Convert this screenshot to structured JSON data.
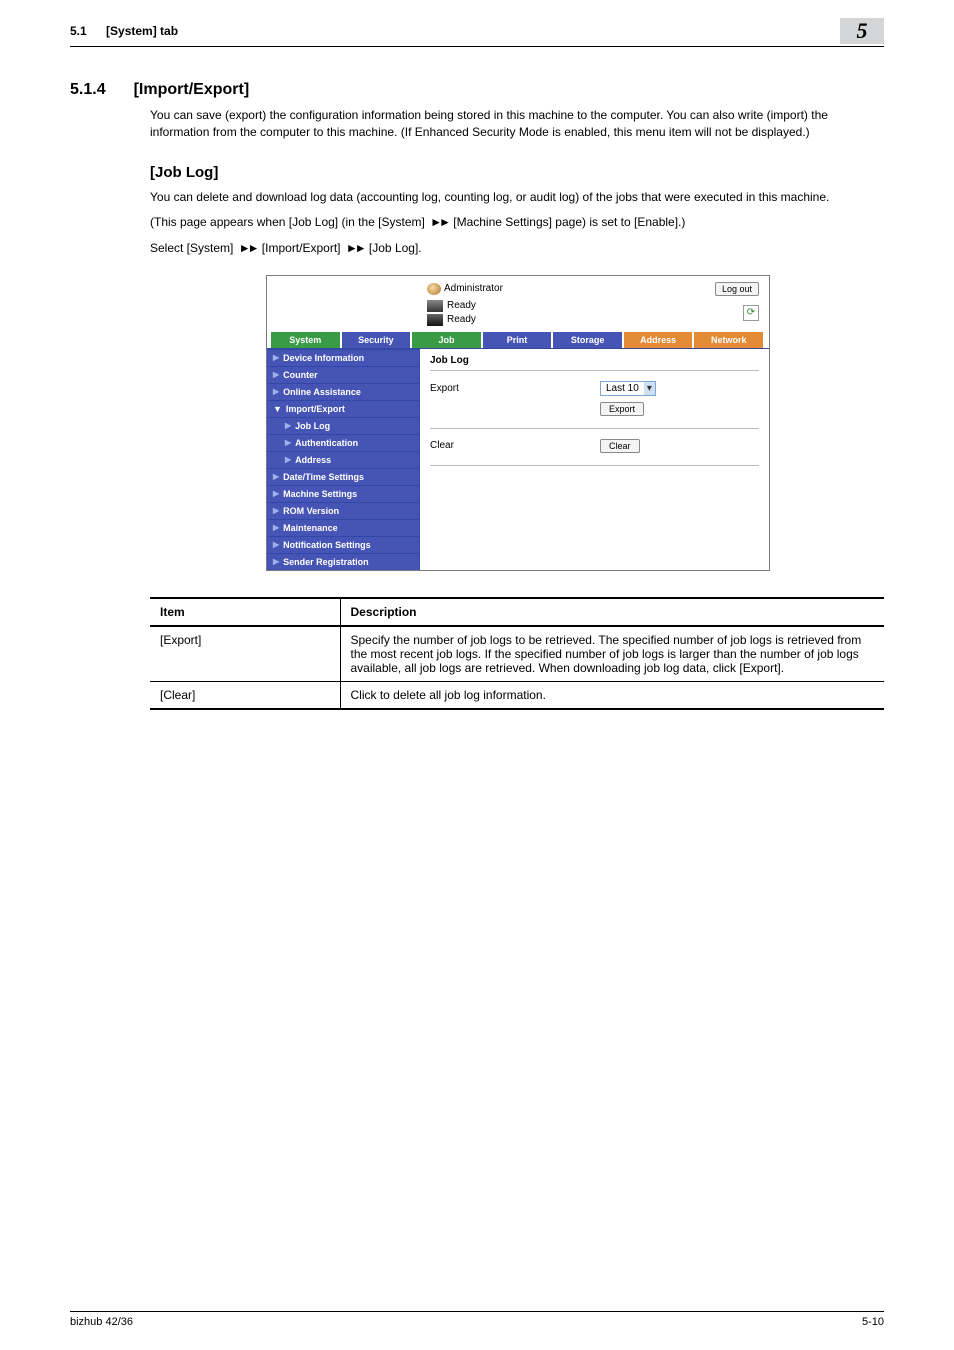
{
  "header": {
    "section_ref": "5.1",
    "section_title": "[System] tab",
    "chapter": "5"
  },
  "section": {
    "number": "5.1.4",
    "title": "[Import/Export]",
    "intro": "You can save (export) the configuration information being stored in this machine to the computer. You can also write (import) the information from the computer to this machine. (If Enhanced Security Mode is enabled, this menu item will not be displayed.)"
  },
  "joblog": {
    "heading": "[Job Log]",
    "p1": "You can delete and download log data (accounting log, counting log, or audit log) of the jobs that were executed in this machine.",
    "p2_pre": "(This page appears when [Job Log] (in the [System] ",
    "p2_mid": " [Machine Settings] page) is set to [Enable].)",
    "p3_a": "Select [System] ",
    "p3_b": " [Import/Export] ",
    "p3_c": " [Job Log]."
  },
  "shot": {
    "user_label": "Administrator",
    "logout": "Log out",
    "status1": "Ready",
    "status2": "Ready",
    "tabs": [
      "System",
      "Security",
      "Job",
      "Print",
      "Storage",
      "Address",
      "Network"
    ],
    "nav": [
      "Device Information",
      "Counter",
      "Online Assistance",
      "Import/Export",
      "Job Log",
      "Authentication",
      "Address",
      "Date/Time Settings",
      "Machine Settings",
      "ROM Version",
      "Maintenance",
      "Notification Settings",
      "Sender Registration"
    ],
    "nav_down_marker": "▼ ",
    "page_title": "Job Log",
    "export_label": "Export",
    "export_value": "Last 10",
    "export_button": "Export",
    "clear_label": "Clear",
    "clear_button": "Clear"
  },
  "table": {
    "head_item": "Item",
    "head_desc": "Description",
    "rows": [
      {
        "item": "[Export]",
        "desc": "Specify the number of job logs to be retrieved. The specified number of job logs is retrieved from the most recent job logs. If the specified number of job logs is larger than the number of job logs available, all job logs are retrieved. When downloading job log data, click [Export]."
      },
      {
        "item": "[Clear]",
        "desc": "Click to delete all job log information."
      }
    ]
  },
  "footer": {
    "model": "bizhub 42/36",
    "page": "5-10"
  }
}
